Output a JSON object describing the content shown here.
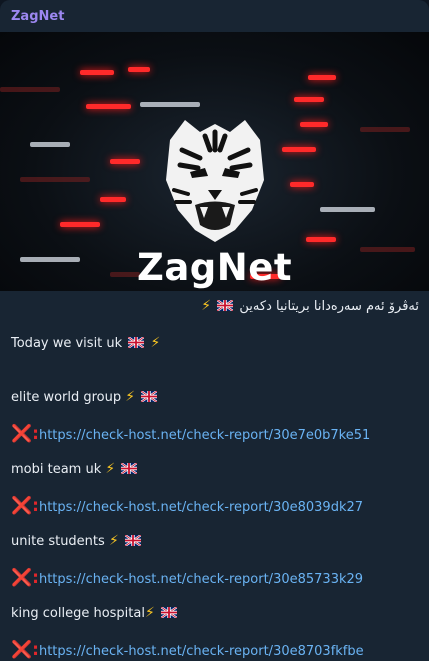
{
  "channel": {
    "name": "ZagNet"
  },
  "banner": {
    "logo_text": "ZagNet"
  },
  "message": {
    "rtl_line": "ئەڤرۆ ئەم سەرەدانا بریتانیا دکەین",
    "intro": "Today we visit uk",
    "targets": [
      {
        "name": "elite world group",
        "link": "https://check-host.net/check-report/30e7e0b7ke51"
      },
      {
        "name": "mobi team uk",
        "link": "https://check-host.net/check-report/30e8039dk27"
      },
      {
        "name": "unite students",
        "link": "https://check-host.net/check-report/30e85733k29"
      },
      {
        "name": "king college hospital",
        "link": "https://check-host.net/check-report/30e8703fkfbe"
      }
    ],
    "x_prefix": "❌:",
    "bolt": "⚡"
  },
  "icons": {
    "flag": "uk-flag-icon",
    "bolt": "lightning-icon",
    "cross": "red-cross-icon"
  },
  "colors": {
    "bubble": "#182533",
    "name": "#9c87f0",
    "link": "#6ab3f3",
    "cross": "#e0272b"
  }
}
